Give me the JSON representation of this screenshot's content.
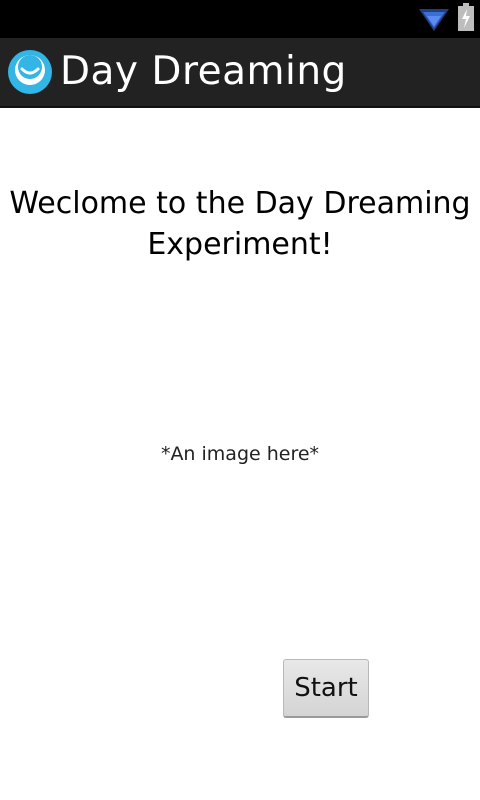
{
  "status_bar": {
    "icons": [
      "wifi-icon",
      "battery-charging-icon"
    ],
    "background": "#000000",
    "icon_color": "#3b6fd6"
  },
  "action_bar": {
    "title": "Day Dreaming",
    "app_icon": "app-logo-icon",
    "background": "#222222",
    "logo_color": "#33b5e5"
  },
  "main": {
    "heading": "Weclome to the Day Dreaming Experiment!",
    "image_placeholder": "*An image here*",
    "start_label": "Start"
  }
}
